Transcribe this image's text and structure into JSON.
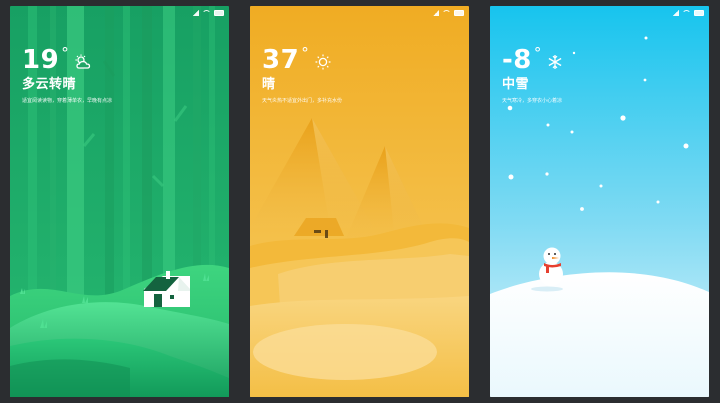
{
  "screens": [
    {
      "id": "forest",
      "temperature": "19",
      "degree_symbol": "°",
      "condition": "多云转晴",
      "tip": "适宜阅读读物，穿着薄单衣，早晚有点凉",
      "icon": "partly-cloudy-icon"
    },
    {
      "id": "desert",
      "temperature": "37",
      "degree_symbol": "°",
      "condition": "晴",
      "tip": "天气炎热不适宜外出门，多补充水份",
      "icon": "sun-icon"
    },
    {
      "id": "snow",
      "temperature": "-8",
      "degree_symbol": "°",
      "condition": "中雪",
      "tip": "天气寒冷，多穿衣小心着凉",
      "icon": "snowflake-icon"
    }
  ],
  "colors": {
    "forest_bg": "#1fa566",
    "desert_bg": "#f1b12a",
    "snow_bg": "#1ec4ec"
  }
}
